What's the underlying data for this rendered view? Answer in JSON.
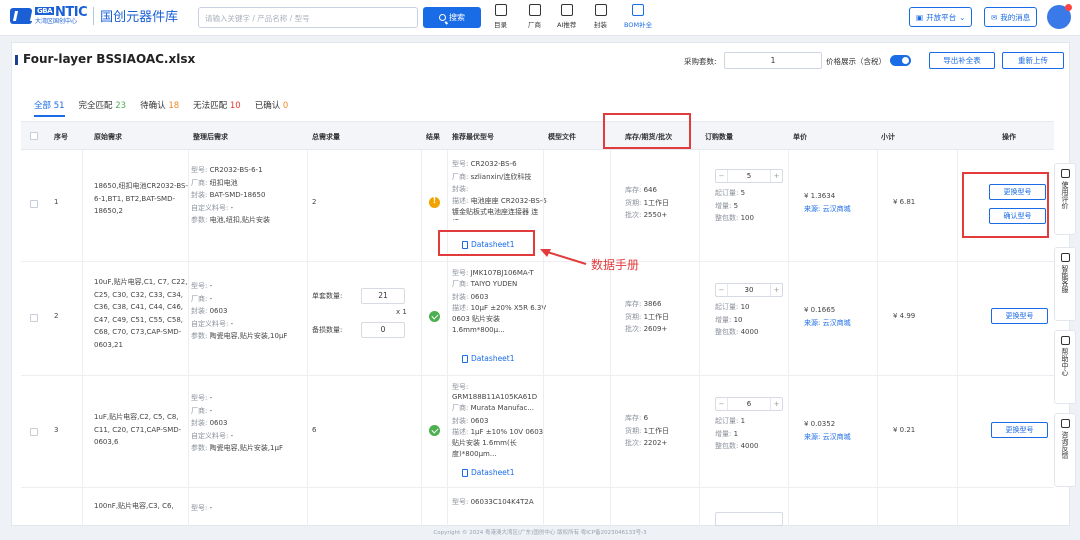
{
  "header": {
    "logo_en": "NTIC",
    "logo_badge": "GBA",
    "logo_sub": "大湾区国创中心",
    "logo_cn": "国创元器件库",
    "search_placeholder": "请输入关键字 / 产品名称 / 型号",
    "search_button": "搜索",
    "nav": [
      {
        "label": "目录",
        "icon": "catalog-icon"
      },
      {
        "label": "厂商",
        "icon": "factory-icon"
      },
      {
        "label": "AI推荐",
        "icon": "ai-icon"
      },
      {
        "label": "封装",
        "icon": "package-icon"
      },
      {
        "label": "BOM补全",
        "icon": "bom-icon"
      }
    ],
    "open_platform": "开放平台",
    "my_messages": "我的消息"
  },
  "toolbar": {
    "file_title": "Four-layer BSSIAOAC.xlsx",
    "purchase_sets_label": "采购套数:",
    "purchase_sets_value": "1",
    "price_display_label": "价格展示（含税）",
    "price_display_on": true,
    "export_button": "导出补全表",
    "reupload_button": "重新上传"
  },
  "tabs": [
    {
      "label": "全部",
      "count": "51",
      "color": "#1a6be6"
    },
    {
      "label": "完全匹配",
      "count": "23",
      "color": "#4caf50"
    },
    {
      "label": "待确认",
      "count": "18",
      "color": "#f08a24"
    },
    {
      "label": "无法匹配",
      "count": "10",
      "color": "#e53935"
    },
    {
      "label": "已确认",
      "count": "0",
      "color": "#f08a24"
    }
  ],
  "table": {
    "headers": [
      "序号",
      "原始需求",
      "整理后需求",
      "总需求量",
      "结果",
      "推荐最优型号",
      "模型文件",
      "库存/期货/批次",
      "订购数量",
      "单价",
      "小计",
      "操作"
    ],
    "field_labels": {
      "model": "型号:",
      "maker": "厂商:",
      "pkg": "封装:",
      "custom": "自定义料号:",
      "params": "参数:",
      "desc": "描述:",
      "stock": "库存:",
      "lead": "货期:",
      "batch": "批次:",
      "min": "起订量:",
      "inc": "增量:",
      "full": "整包数:",
      "source": "来源:",
      "single_qty": "单套数量:",
      "spare_qty": "备损数量:"
    },
    "rows": [
      {
        "no": "1",
        "raw": "18650,纽扣电池CR2032-BS-6-1,BT1, BT2,BAT-SMD-18650,2",
        "model": "CR2032-BS-6-1",
        "maker": "纽扣电池",
        "pkg": "BAT-SMD-18650",
        "custom": "-",
        "params": "电池,纽扣,贴片安装",
        "total": "2",
        "status": "warn",
        "rec_model": "CR2032-BS-6",
        "rec_maker": "szlianxin/连欣科技",
        "rec_pkg": "",
        "rec_desc": "电池座座 CR2032-BS-6镀金贴板式电池座连接器 连接...",
        "datasheet": "Datasheet1",
        "stock": "646",
        "lead": "1工作日",
        "batch": "2550+",
        "order_qty": "5",
        "min": "5",
        "inc": "5",
        "full": "100",
        "price": "¥ 1.3634",
        "source": "云汉商城",
        "subtotal": "¥ 6.81",
        "actions": [
          "更换型号",
          "确认型号"
        ]
      },
      {
        "no": "2",
        "raw": "10uF,贴片电容,C1, C7, C22, C25, C30, C32, C33, C34, C36, C38, C41, C44, C46, C47, C49, C51, C55, C58, C68, C70, C73,CAP-SMD-0603,21",
        "model": "-",
        "maker": "-",
        "pkg": "0603",
        "custom": "-",
        "params": "陶瓷电容,贴片安装,10μF",
        "single_qty": "21",
        "multiplier": "x 1",
        "spare_qty": "0",
        "status": "ok",
        "rec_model": "JMK107BJ106MA-T",
        "rec_maker": "TAIYO YUDEN",
        "rec_pkg": "0603",
        "rec_desc": "10μF ±20% X5R 6.3V 0603 贴片安装 1.6mm*800μ...",
        "datasheet": "Datasheet1",
        "stock": "3866",
        "lead": "1工作日",
        "batch": "2609+",
        "order_qty": "30",
        "min": "10",
        "inc": "10",
        "full": "4000",
        "price": "¥ 0.1665",
        "source": "云汉商城",
        "subtotal": "¥ 4.99",
        "actions": [
          "更换型号"
        ]
      },
      {
        "no": "3",
        "raw": "1uF,贴片电容,C2, C5, C8, C11, C20, C71,CAP-SMD-0603,6",
        "model": "-",
        "maker": "-",
        "pkg": "0603",
        "custom": "-",
        "params": "陶瓷电容,贴片安装,1μF",
        "total": "6",
        "status": "ok",
        "rec_model": "GRM188B11A105KA61D",
        "rec_maker": "Murata Manufac...",
        "rec_pkg": "0603",
        "rec_desc": "1μF ±10% 10V 0603 贴片安装 1.6mm(长度)*800μm...",
        "datasheet": "Datasheet1",
        "stock": "6",
        "lead": "1工作日",
        "batch": "2202+",
        "order_qty": "6",
        "min": "1",
        "inc": "1",
        "full": "4000",
        "price": "¥ 0.0352",
        "source": "云汉商城",
        "subtotal": "¥ 0.21",
        "actions": [
          "更换型号"
        ]
      },
      {
        "no": "",
        "raw": "100nF,贴片电容,C3, C6,",
        "model": "-",
        "rec_model": "06033C104K4T2A"
      }
    ]
  },
  "annotation": "数据手册",
  "side_tools": [
    "使用评价",
    "智能客服",
    "帮助中心",
    "咨询反馈"
  ],
  "footer": "Copyright © 2024 粤港澳大湾区(广东)国创中心 版权所有    粤ICP备2023046133号-3"
}
